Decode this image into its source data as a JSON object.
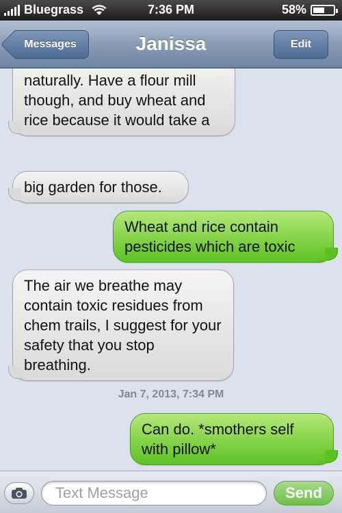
{
  "status_bar": {
    "carrier": "Bluegrass",
    "time": "7:36 PM",
    "battery_text": "58%",
    "battery_level": 0.58,
    "signal_icon": "signal-bars-icon",
    "wifi_icon": "wifi-icon",
    "battery_icon": "battery-icon"
  },
  "nav": {
    "back_label": "Messages",
    "title": "Janissa",
    "edit_label": "Edit"
  },
  "messages": [
    {
      "direction": "incoming",
      "text": "naturally. Have a flour mill though, and buy wheat and rice because it would take a"
    },
    {
      "direction": "incoming",
      "text": "big garden for those."
    },
    {
      "direction": "outgoing",
      "text": "Wheat and rice contain pesticides which are toxic"
    },
    {
      "direction": "incoming",
      "text": "The air we breathe may contain toxic residues from chem trails, I suggest for your safety that you stop breathing."
    },
    {
      "direction": "outgoing",
      "text": "Can do. *smothers self with pillow*"
    }
  ],
  "timestamp": "Jan 7, 2013, 7:34 PM",
  "input_bar": {
    "camera_icon": "camera-icon",
    "placeholder": "Text Message",
    "send_label": "Send"
  },
  "colors": {
    "incoming_bubble": "#e6e6e6",
    "outgoing_bubble": "#7ed146",
    "nav_bar": "#8a9cb5",
    "background": "#dbe2ed",
    "send_button": "#6dbd4b"
  }
}
